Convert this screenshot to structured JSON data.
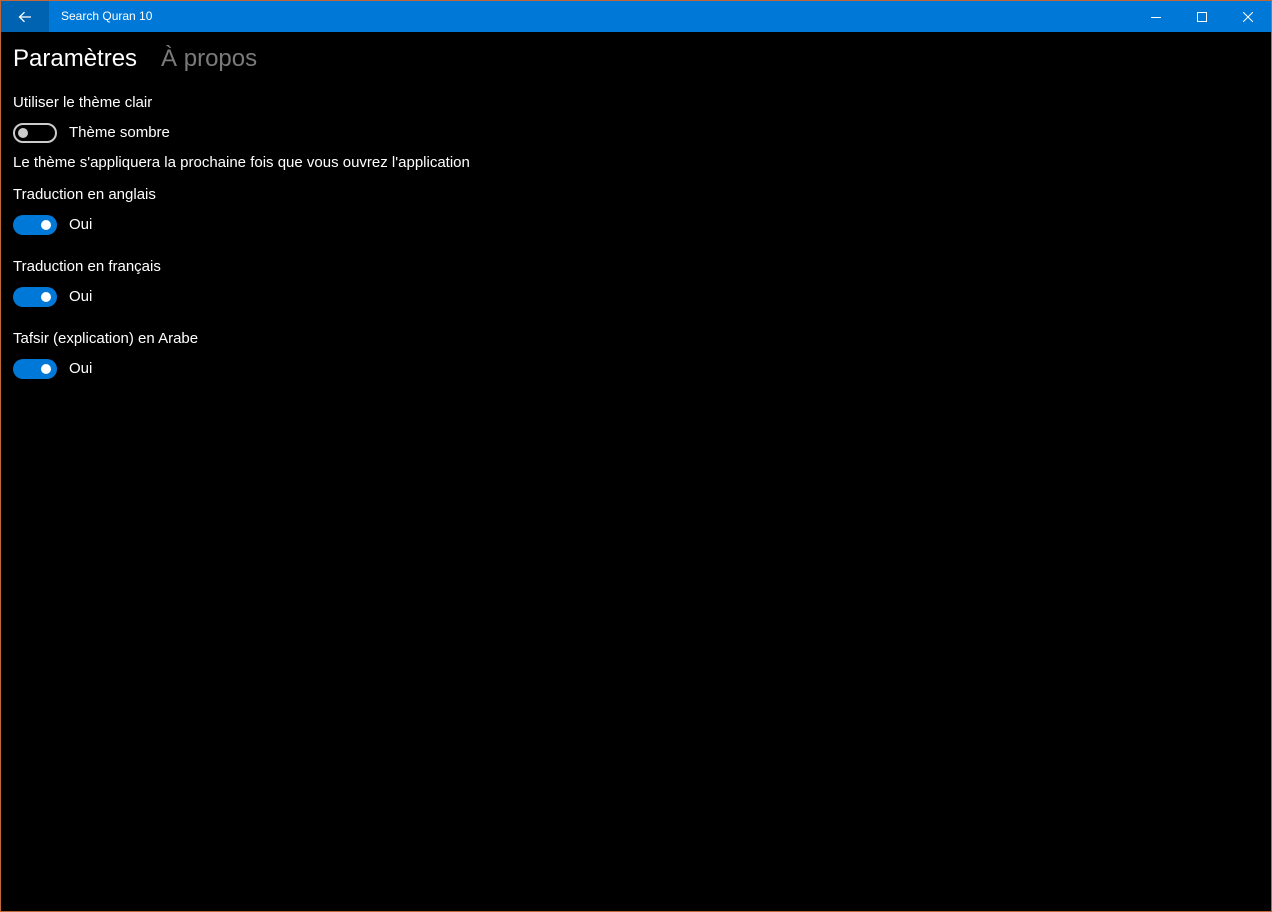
{
  "titlebar": {
    "title": "Search Quran 10",
    "back_icon": "back-arrow-icon",
    "minimize_icon": "minimize-icon",
    "maximize_icon": "maximize-icon",
    "close_icon": "close-icon"
  },
  "pivot": {
    "tabs": [
      {
        "label": "Paramètres",
        "selected": true
      },
      {
        "label": "À propos",
        "selected": false
      }
    ]
  },
  "settings": {
    "theme": {
      "header": "Utiliser le thème clair",
      "state_label": "Thème sombre",
      "is_on": false,
      "note": "Le thème s'appliquera la prochaine fois que vous ouvrez l'application"
    },
    "english_translation": {
      "header": "Traduction en anglais",
      "state_label": "Oui",
      "is_on": true
    },
    "french_translation": {
      "header": "Traduction en français",
      "state_label": "Oui",
      "is_on": true
    },
    "tafsir_arabic": {
      "header": "Tafsir (explication) en Arabe",
      "state_label": "Oui",
      "is_on": true
    }
  },
  "colors": {
    "accent": "#0078d7",
    "titlebar": "#0078d7",
    "back_button": "#0063b1",
    "background": "#000000",
    "inactive_tab": "#7a7a7a"
  }
}
